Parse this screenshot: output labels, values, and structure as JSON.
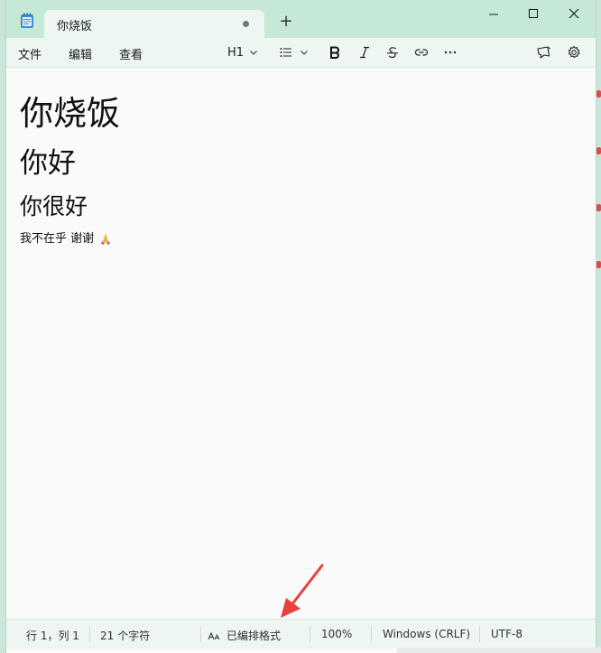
{
  "window": {
    "tab_title": "你烧饭",
    "new_tab_symbol": "+"
  },
  "menu": {
    "file": "文件",
    "edit": "编辑",
    "view": "查看"
  },
  "toolbar": {
    "heading_level": "H1",
    "icons": [
      "list-icon",
      "bold-icon",
      "italic-icon",
      "strikethrough-icon",
      "link-icon",
      "more-icon",
      "copilot-icon",
      "gear-icon"
    ]
  },
  "document": {
    "h1": "你烧饭",
    "h2": "你好",
    "h3": "你很好",
    "paragraph": "我不在乎 谢谢"
  },
  "status": {
    "position": "行 1，列 1",
    "char_count": "21 个字符",
    "formatting": "已编排格式",
    "zoom": "100%",
    "line_ending": "Windows (CRLF)",
    "encoding": "UTF-8"
  },
  "colors": {
    "titlebar": "#c6e8d6",
    "tab_active": "#eef6f1",
    "editor_bg": "#fafafa",
    "annotation_arrow": "#e8403a"
  }
}
